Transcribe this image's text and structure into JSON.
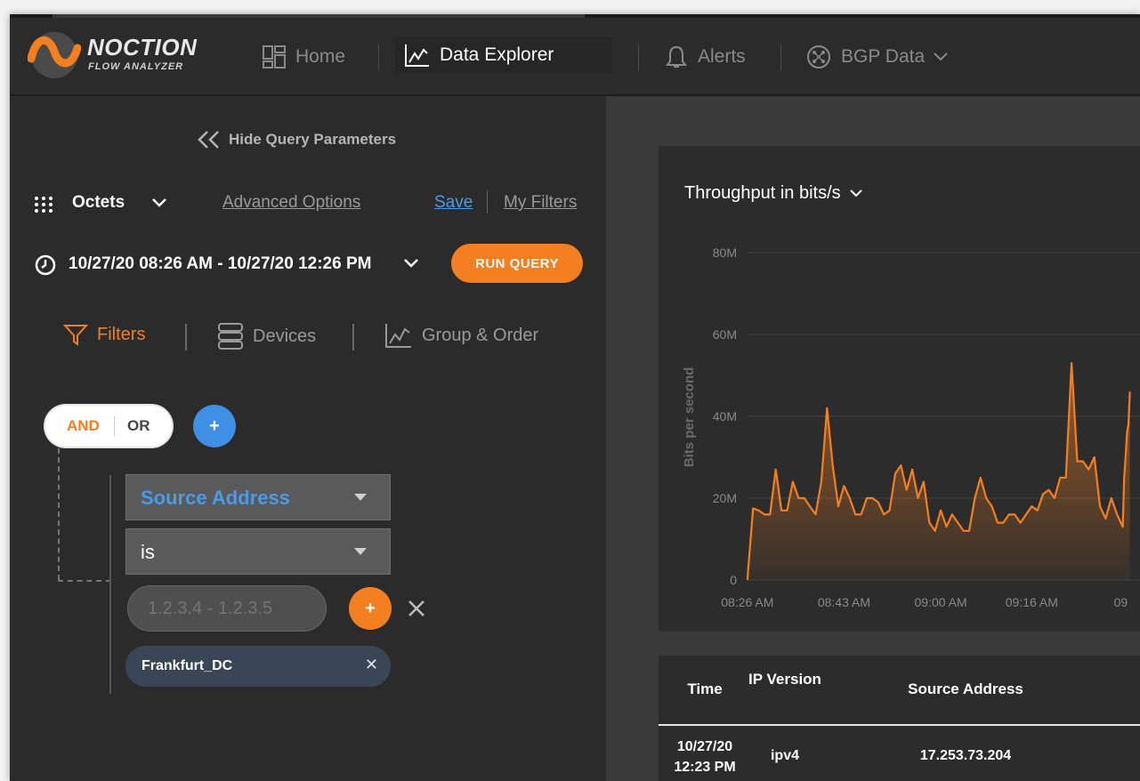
{
  "brand": {
    "name": "NOCTION",
    "sub": "FLOW ANALYZER"
  },
  "nav": {
    "home": "Home",
    "explorer": "Data Explorer",
    "alerts": "Alerts",
    "bgp": "BGP Data"
  },
  "query": {
    "hide_label": "Hide Query Parameters",
    "metric": "Octets",
    "advanced": "Advanced Options",
    "save": "Save",
    "my_filters": "My Filters",
    "date_range": "10/27/20 08:26 AM - 10/27/20 12:26 PM",
    "run": "RUN QUERY"
  },
  "tabs": {
    "filters": "Filters",
    "devices": "Devices",
    "group": "Group & Order"
  },
  "filter": {
    "and": "AND",
    "or": "OR",
    "field": "Source Address",
    "operator": "is",
    "value_placeholder": "1.2.3.4 - 1.2.3.5",
    "tag": "Frankfurt_DC"
  },
  "colors": {
    "accent": "#f47f20",
    "link": "#4a9be8"
  },
  "chart_data": {
    "type": "area",
    "title": "Throughput in bits/s",
    "ylabel": "Bits per second",
    "ytick_labels": [
      "0",
      "20M",
      "40M",
      "60M",
      "80M"
    ],
    "ylim": [
      0,
      80
    ],
    "xtick_labels": [
      "08:26 AM",
      "08:43 AM",
      "09:00 AM",
      "09:16 AM",
      "09"
    ],
    "x_ticks": [
      0,
      17,
      34,
      50,
      66
    ],
    "xlim": [
      -2,
      67
    ],
    "x": [
      0,
      1,
      2,
      3,
      4,
      5,
      6,
      7,
      8,
      9,
      10,
      11,
      12,
      13,
      14,
      15,
      16,
      17,
      18,
      19,
      20,
      21,
      22,
      23,
      24,
      25,
      26,
      27,
      28,
      29,
      30,
      31,
      32,
      33,
      34,
      35,
      36,
      37,
      38,
      39,
      40,
      41,
      42,
      43,
      44,
      45,
      46,
      47,
      48,
      49,
      50,
      51,
      52,
      53,
      54,
      55,
      56,
      57,
      58,
      59,
      60,
      61,
      62,
      63,
      64,
      65,
      66
    ],
    "values": [
      0,
      17.5,
      17,
      16,
      16,
      27,
      17,
      17,
      24,
      20,
      20,
      18,
      16,
      24,
      42,
      28,
      18,
      23,
      20,
      16,
      16,
      20,
      20,
      19,
      16,
      17,
      26,
      28,
      22,
      27,
      20,
      24,
      14,
      12,
      17,
      13,
      16,
      14,
      12,
      12,
      20,
      25,
      20,
      18,
      14,
      14,
      16,
      16,
      14,
      16,
      18,
      17,
      21,
      22,
      20,
      25,
      25,
      53,
      29,
      29,
      27,
      30,
      18,
      15,
      20,
      16,
      13
    ],
    "values_tail": [
      25,
      30,
      36,
      38,
      46
    ],
    "fill_color": "#f47f20"
  },
  "table": {
    "headers": [
      "Time",
      "IP Version",
      "Source Address"
    ],
    "rows": [
      {
        "time": "10/27/20 12:23 PM",
        "ip": "ipv4",
        "src": "17.253.73.204"
      }
    ]
  }
}
